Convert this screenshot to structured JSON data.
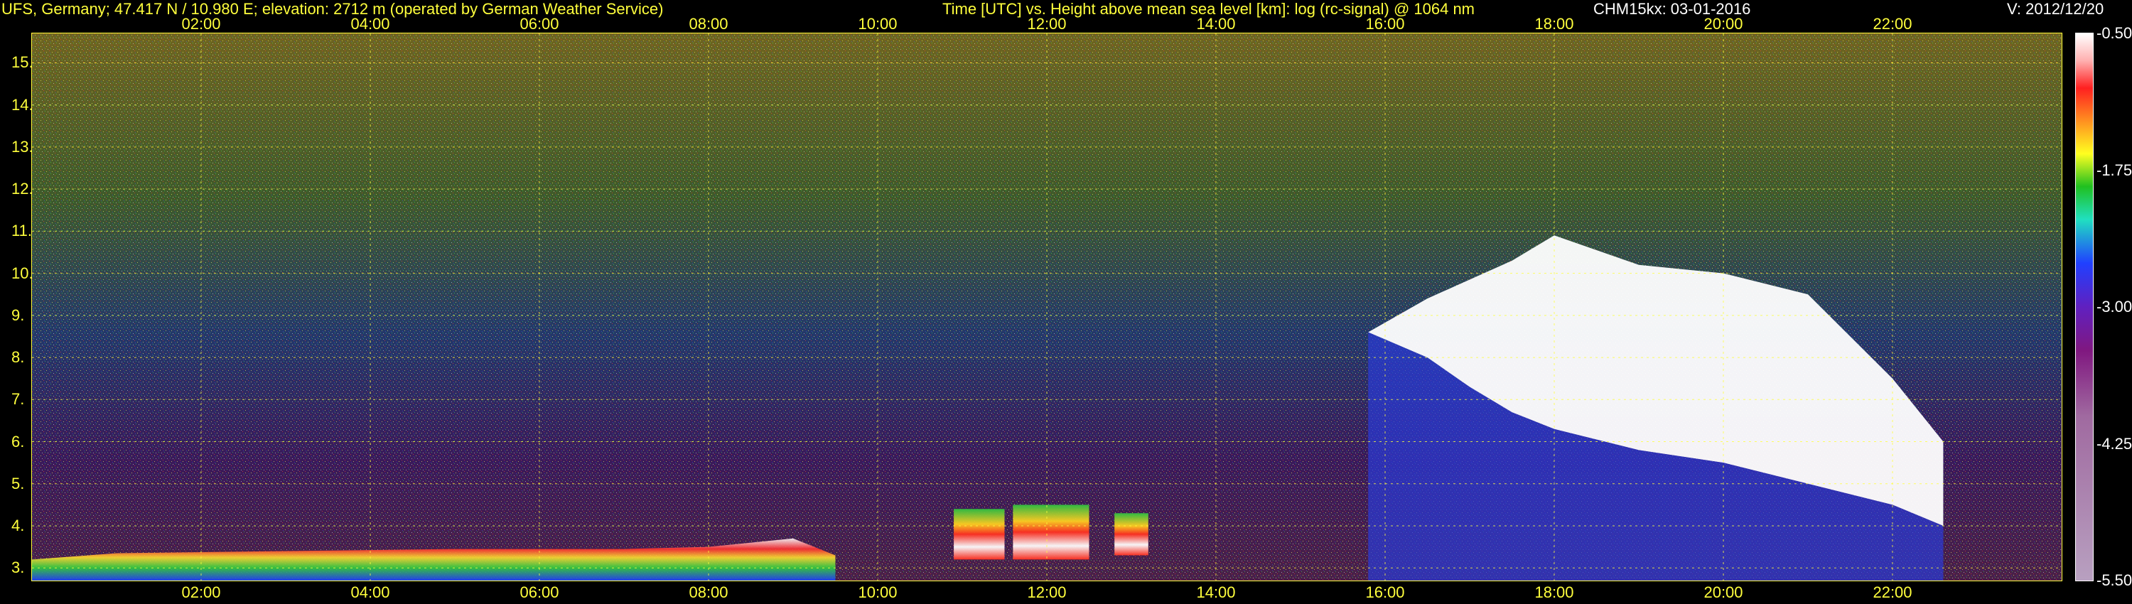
{
  "header": {
    "site": "UFS, Germany; 47.417 N / 10.980 E; elevation: 2712 m  (operated by German Weather Service)",
    "title": "Time [UTC] vs. Height above mean sea level [km]: log (rc-signal) @ 1064 nm",
    "instrument": "CHM15kx: 03-01-2016",
    "version": "V: 2012/12/20"
  },
  "chart_data": {
    "type": "heatmap",
    "title": "Time [UTC] vs. Height above mean sea level [km]: log (rc-signal) @ 1064 nm",
    "xlabel": "Time [UTC]",
    "ylabel": "Height above mean sea level [km]",
    "x_unit": "hours UTC",
    "xlim": [
      0.0,
      24.0
    ],
    "ylim": [
      2.7,
      15.7
    ],
    "x_ticks": [
      "02:00",
      "04:00",
      "06:00",
      "08:00",
      "10:00",
      "12:00",
      "14:00",
      "16:00",
      "18:00",
      "20:00",
      "22:00"
    ],
    "x_tick_values": [
      2,
      4,
      6,
      8,
      10,
      12,
      14,
      16,
      18,
      20,
      22
    ],
    "y_ticks": [
      "3.",
      "4.",
      "5.",
      "6.",
      "7.",
      "8.",
      "9.",
      "10.",
      "11.",
      "12.",
      "13.",
      "14.",
      "15."
    ],
    "y_tick_values": [
      3,
      4,
      5,
      6,
      7,
      8,
      9,
      10,
      11,
      12,
      13,
      14,
      15
    ],
    "grid": true,
    "colorbar": {
      "ticks": [
        "-0.50",
        "-1.75",
        "-3.00",
        "-4.25",
        "-5.50"
      ],
      "tick_values": [
        -0.5,
        -1.75,
        -3.0,
        -4.25,
        -5.5
      ],
      "range": [
        -5.5,
        -0.5
      ]
    },
    "features": {
      "boundary_layer_top_km": [
        [
          0.0,
          3.2
        ],
        [
          1.0,
          3.35
        ],
        [
          3.0,
          3.4
        ],
        [
          5.0,
          3.45
        ],
        [
          7.0,
          3.45
        ],
        [
          8.0,
          3.5
        ],
        [
          9.0,
          3.7
        ],
        [
          9.5,
          3.3
        ]
      ],
      "low_cloud_segments": [
        {
          "start": 10.9,
          "end": 11.5,
          "base": 3.2,
          "top": 4.4
        },
        {
          "start": 11.6,
          "end": 12.5,
          "base": 3.2,
          "top": 4.5
        },
        {
          "start": 12.8,
          "end": 13.2,
          "base": 3.3,
          "top": 4.3
        }
      ],
      "cirrus_base_km": [
        [
          15.8,
          8.6
        ],
        [
          16.5,
          8.0
        ],
        [
          17.0,
          7.3
        ],
        [
          17.5,
          6.7
        ],
        [
          18.0,
          6.3
        ],
        [
          19.0,
          5.8
        ],
        [
          20.0,
          5.5
        ],
        [
          21.0,
          5.0
        ],
        [
          22.0,
          4.5
        ],
        [
          22.6,
          4.0
        ]
      ],
      "cirrus_top_km": [
        [
          15.8,
          8.6
        ],
        [
          16.5,
          9.4
        ],
        [
          17.5,
          10.3
        ],
        [
          18.0,
          10.9
        ],
        [
          19.0,
          10.2
        ],
        [
          20.0,
          10.0
        ],
        [
          21.0,
          9.5
        ],
        [
          22.0,
          7.5
        ],
        [
          22.6,
          6.0
        ]
      ]
    }
  }
}
